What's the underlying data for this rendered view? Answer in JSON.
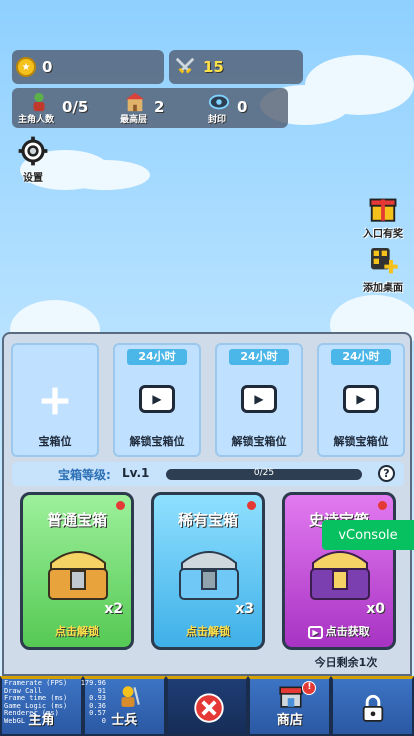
{
  "stats": {
    "coins": "0",
    "swords": "15",
    "heroes_label": "主角人数",
    "heroes_value": "0/5",
    "floor_label": "最高层",
    "floor_value": "2",
    "seal_label": "封印",
    "seal_value": "0"
  },
  "settings_label": "设置",
  "side": {
    "entry_reward": "入口有奖",
    "add_desktop": "添加桌面"
  },
  "slots": [
    {
      "time": "",
      "label": "宝箱位"
    },
    {
      "time": "24小时",
      "label": "解锁宝箱位"
    },
    {
      "time": "24小时",
      "label": "解锁宝箱位"
    },
    {
      "time": "24小时",
      "label": "解锁宝箱位"
    }
  ],
  "level": {
    "label": "宝箱等级:",
    "value": "Lv.1",
    "progress_text": "0/25",
    "progress": 0.0,
    "help": "?"
  },
  "chests": [
    {
      "title": "普通宝箱",
      "count": "x2",
      "action": "点击解锁",
      "color": "#7be07a"
    },
    {
      "title": "稀有宝箱",
      "count": "x3",
      "action": "点击解锁",
      "color": "#5cc8f2"
    },
    {
      "title": "史诗宝箱",
      "count": "x0",
      "action": "点击获取",
      "color": "#c54cd9"
    }
  ],
  "daily_remaining": "今日剩余1次",
  "vconsole": "vConsole",
  "nav": [
    {
      "label": "主角"
    },
    {
      "label": "士兵"
    },
    {
      "label": ""
    },
    {
      "label": "商店"
    },
    {
      "label": ""
    }
  ],
  "debug": [
    {
      "k": "Framerate (FPS)",
      "v": "179.96"
    },
    {
      "k": "Draw Call",
      "v": "91"
    },
    {
      "k": "Frame time (ms)",
      "v": "0.93"
    },
    {
      "k": "Game Logic (ms)",
      "v": "0.36"
    },
    {
      "k": "Renderer (ms)",
      "v": "0.57"
    },
    {
      "k": "WebGL",
      "v": "0"
    }
  ]
}
